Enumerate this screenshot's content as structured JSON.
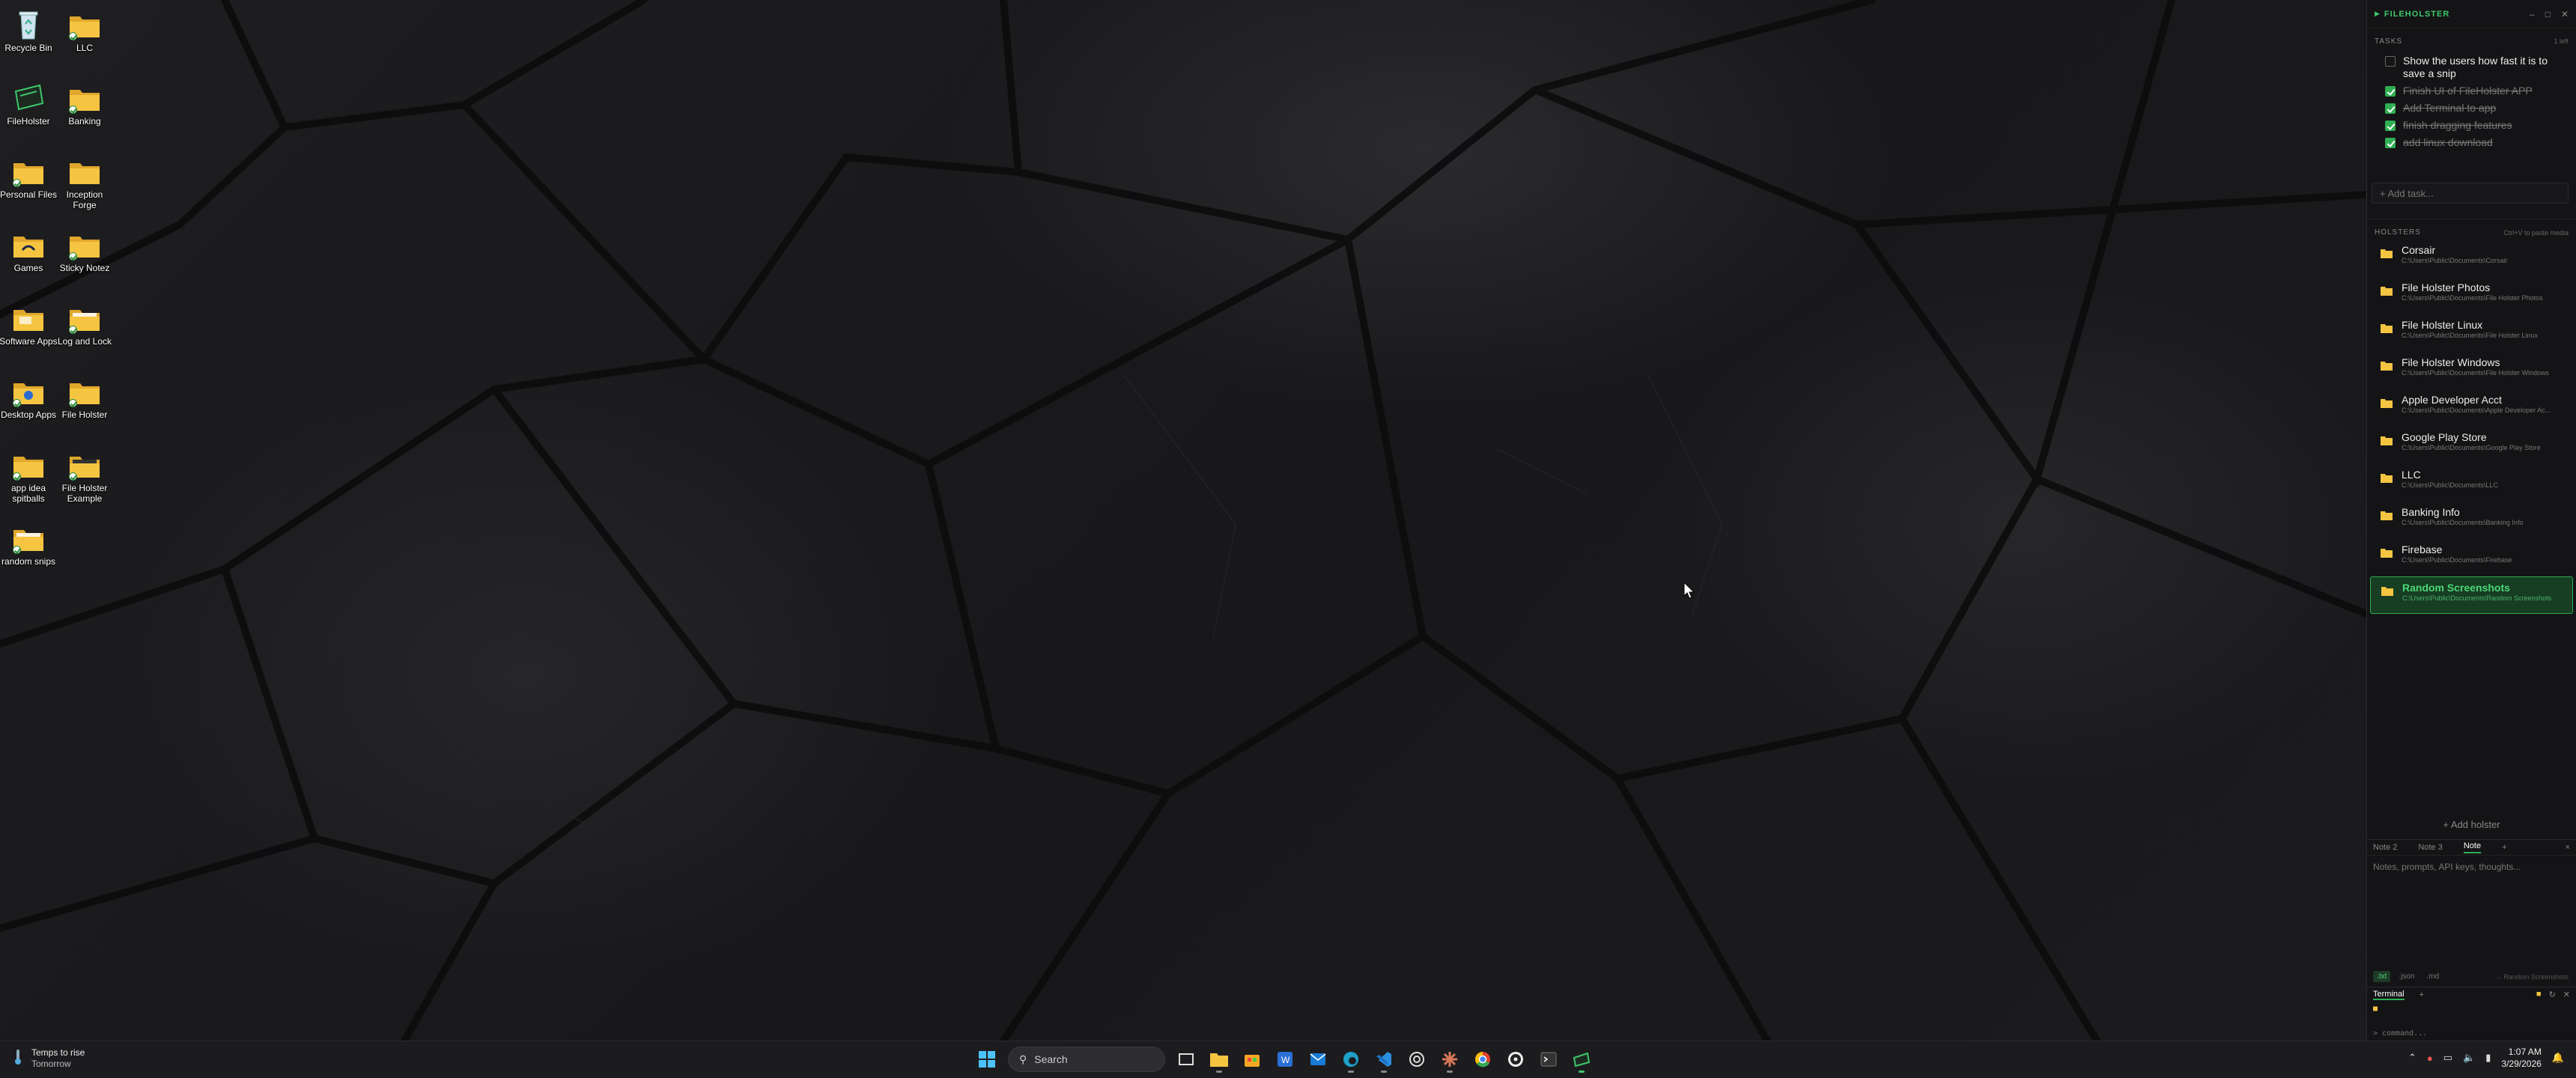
{
  "desktop": {
    "icons": [
      {
        "label": "Recycle Bin",
        "kind": "recycle-bin"
      },
      {
        "label": "LLC",
        "kind": "folder"
      },
      {
        "label": "FileHolster",
        "kind": "app"
      },
      {
        "label": "Banking",
        "kind": "folder"
      },
      {
        "label": "Personal Files",
        "kind": "folder"
      },
      {
        "label": "Inception Forge",
        "kind": "folder"
      },
      {
        "label": "Games",
        "kind": "folder"
      },
      {
        "label": "Sticky Notez",
        "kind": "folder"
      },
      {
        "label": "Software Apps",
        "kind": "folder"
      },
      {
        "label": "Log and Lock",
        "kind": "folder"
      },
      {
        "label": "Desktop Apps",
        "kind": "folder"
      },
      {
        "label": "File Holster",
        "kind": "folder"
      },
      {
        "label": "app idea spitballs",
        "kind": "folder"
      },
      {
        "label": "File Holster Example",
        "kind": "folder"
      },
      {
        "label": "random snips",
        "kind": "folder"
      }
    ]
  },
  "panel": {
    "title": "FILEHOLSTER",
    "tasks_header": "TASKS",
    "tasks_count": "1 left",
    "tasks": [
      {
        "text": "Show the users how fast it is to save a snip",
        "done": false
      },
      {
        "text": "Finish UI of FileHolster APP",
        "done": true
      },
      {
        "text": "Add Terminal to app",
        "done": true
      },
      {
        "text": "finish dragging features",
        "done": true
      },
      {
        "text": "add linux download",
        "done": true
      }
    ],
    "add_task_placeholder": "+ Add task...",
    "holsters_header": "HOLSTERS",
    "holsters_hint": "Ctrl+V to paste media",
    "holsters": [
      {
        "name": "Corsair",
        "path": "C:\\Users\\Public\\Documents\\Corsair",
        "active": false
      },
      {
        "name": "File Holster Photos",
        "path": "C:\\Users\\Public\\Documents\\File Holster Photos",
        "active": false
      },
      {
        "name": "File Holster Linux",
        "path": "C:\\Users\\Public\\Documents\\File Holster Linux",
        "active": false
      },
      {
        "name": "File Holster Windows",
        "path": "C:\\Users\\Public\\Documents\\File Holster Windows",
        "active": false
      },
      {
        "name": "Apple Developer Acct",
        "path": "C:\\Users\\Public\\Documents\\Apple Developer Ac...",
        "active": false
      },
      {
        "name": "Google Play Store",
        "path": "C:\\Users\\Public\\Documents\\Google Play Store",
        "active": false
      },
      {
        "name": "LLC",
        "path": "C:\\Users\\Public\\Documents\\LLC",
        "active": false
      },
      {
        "name": "Banking Info",
        "path": "C:\\Users\\Public\\Documents\\Banking Info",
        "active": false
      },
      {
        "name": "Firebase",
        "path": "C:\\Users\\Public\\Documents\\Firebase",
        "active": false
      },
      {
        "name": "Random Screenshots",
        "path": "C:\\Users\\Public\\Documents\\Random Screenshots",
        "active": true
      }
    ],
    "add_holster": "+ Add holster",
    "note_tabs": [
      "Note 2",
      "Note 3",
      "Note"
    ],
    "note_active": "Note",
    "note_add": "+",
    "note_close": "×",
    "note_placeholder": "Notes, prompts, API keys, thoughts...",
    "note_formats": [
      ".txt",
      ".json",
      ".md"
    ],
    "note_target": "→ Random Screenshots",
    "terminal_tab": "Terminal",
    "terminal_add": "+",
    "terminal_prompt": "> command..."
  },
  "taskbar": {
    "weather_line1": "Temps to rise",
    "weather_line2": "Tomorrow",
    "search_label": "Search",
    "apps": [
      "start-icon",
      "search",
      "task-view-icon",
      "file-explorer-icon",
      "store-icon",
      "word-icon",
      "outlook-icon",
      "edge-icon",
      "vscode-icon",
      "chatgpt-icon",
      "claude-icon",
      "chrome-icon",
      "obs-icon",
      "terminal-icon",
      "fileholster-icon"
    ],
    "time": "1:07 AM",
    "date": "3/29/2026"
  },
  "colors": {
    "accent": "#2fae52",
    "folder": "#f5c542",
    "panel_bg": "#141416"
  }
}
